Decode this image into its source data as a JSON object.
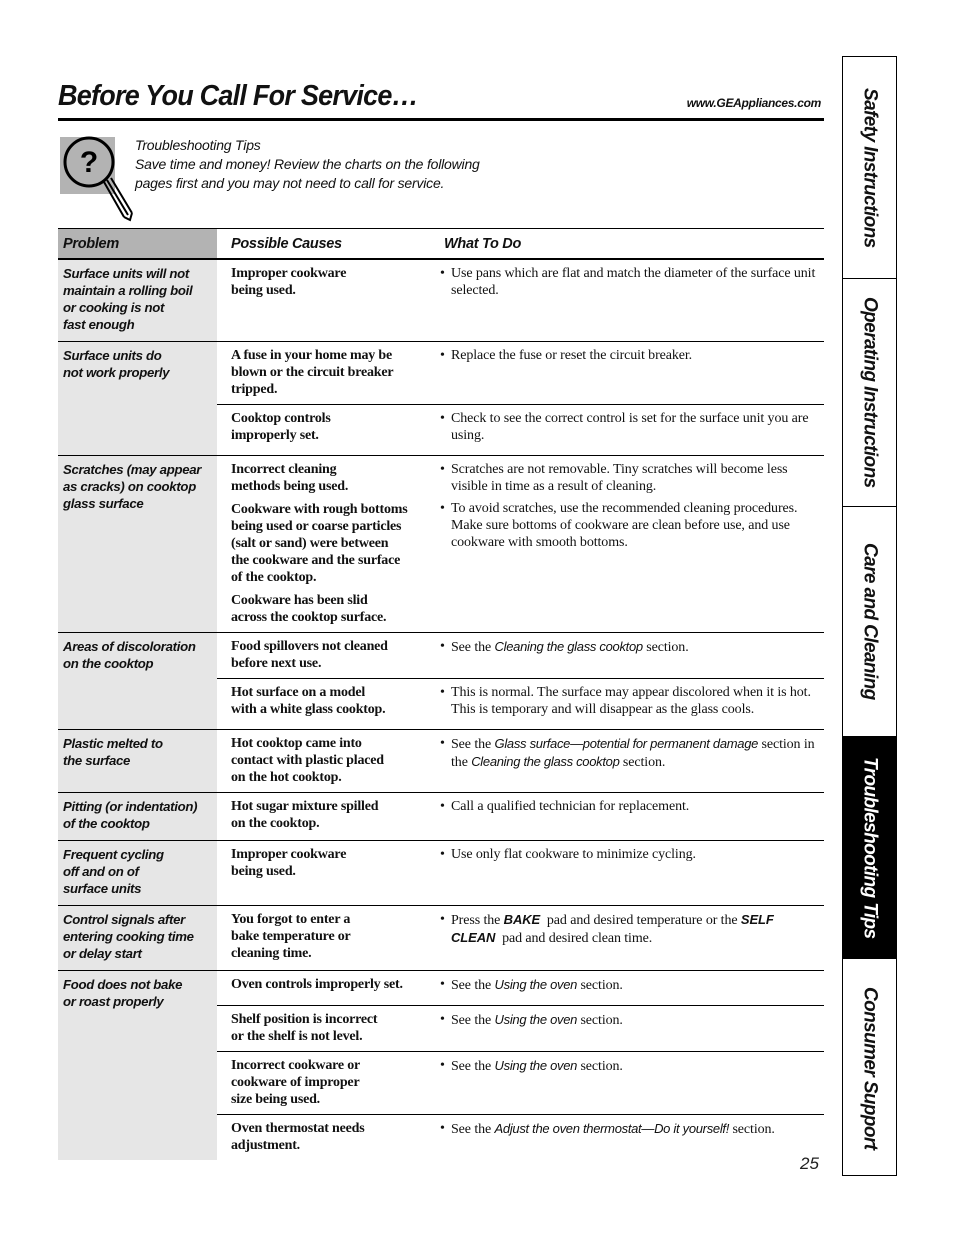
{
  "header": {
    "title": "Before You Call For Service…",
    "url": "www.GEAppliances.com"
  },
  "intro": {
    "icon": "magnifier-question-icon",
    "heading": "Troubleshooting Tips",
    "line1": "Save time and money! Review the charts on the following",
    "line2": "pages first and you may not need to call for service."
  },
  "table": {
    "columns": [
      "Problem",
      "Possible Causes",
      "What To Do"
    ],
    "rows": [
      {
        "problem": [
          "Surface units will not",
          "maintain a rolling boil",
          "or cooking is not",
          "fast enough"
        ],
        "causes": [
          {
            "cause": [
              "Improper cookware",
              "being used."
            ],
            "todo": [
              [
                {
                  "t": "Use pans which are flat and match the diameter of the surface unit selected."
                }
              ]
            ]
          }
        ]
      },
      {
        "problem": [
          "Surface units do",
          "not work properly"
        ],
        "causes": [
          {
            "cause": [
              "A fuse in your home may be",
              "blown or the circuit breaker",
              "tripped."
            ],
            "todo": [
              [
                {
                  "t": "Replace the fuse or reset the circuit breaker."
                }
              ]
            ]
          },
          {
            "divided": true,
            "cause": [
              "Cooktop controls",
              "improperly set."
            ],
            "todo": [
              [
                {
                  "t": "Check to see the correct control is set for the surface unit you are using."
                }
              ]
            ]
          }
        ]
      },
      {
        "problem": [
          "Scratches (may appear",
          "as cracks) on cooktop",
          "glass surface"
        ],
        "causes": [
          {
            "cause": [
              "Incorrect cleaning",
              "methods being used.",
              "",
              "Cookware with rough bottoms",
              "being used or coarse particles",
              "(salt or sand) were between",
              "the cookware and the surface",
              "of the cooktop.",
              "",
              "Cookware has been slid",
              "across the cooktop surface."
            ],
            "todo": [
              [
                {
                  "t": "Scratches are not removable. Tiny scratches will become less visible in time as a result of cleaning."
                }
              ],
              [
                {
                  "t": "To avoid scratches, use the recommended cleaning procedures. Make sure bottoms of cookware are clean before use, and use cookware with smooth bottoms."
                }
              ]
            ]
          }
        ]
      },
      {
        "problem": [
          "Areas of discoloration",
          "on the cooktop"
        ],
        "causes": [
          {
            "cause": [
              "Food spillovers not cleaned",
              "before next use."
            ],
            "todo": [
              [
                {
                  "t": "See the "
                },
                {
                  "t": "Cleaning the glass cooktop",
                  "s": "it"
                },
                {
                  "t": " section."
                }
              ]
            ]
          },
          {
            "divided": true,
            "cause": [
              "Hot surface on a model",
              "with a white glass cooktop."
            ],
            "todo": [
              [
                {
                  "t": "This is normal. The surface may appear discolored when it is hot. This is temporary and will disappear as the glass cools."
                }
              ]
            ]
          }
        ]
      },
      {
        "problem": [
          "Plastic melted to",
          "the surface"
        ],
        "causes": [
          {
            "cause": [
              "Hot cooktop came into",
              "contact with plastic placed",
              "on the hot cooktop."
            ],
            "todo": [
              [
                {
                  "t": "See the "
                },
                {
                  "t": "Glass surface—potential for permanent damage",
                  "s": "it"
                },
                {
                  "t": " section in the "
                },
                {
                  "t": "Cleaning the glass cooktop",
                  "s": "it"
                },
                {
                  "t": " section."
                }
              ]
            ]
          }
        ]
      },
      {
        "problem": [
          "Pitting (or indentation)",
          "of the cooktop"
        ],
        "causes": [
          {
            "cause": [
              "Hot sugar mixture spilled",
              "on the cooktop."
            ],
            "todo": [
              [
                {
                  "t": "Call a qualified technician for replacement."
                }
              ]
            ]
          }
        ]
      },
      {
        "problem": [
          "Frequent cycling",
          "off and on of",
          "surface units"
        ],
        "causes": [
          {
            "cause": [
              "Improper cookware",
              "being used."
            ],
            "todo": [
              [
                {
                  "t": "Use only flat cookware to minimize cycling."
                }
              ]
            ]
          }
        ]
      },
      {
        "problem": [
          "Control signals after",
          "entering cooking time",
          "or delay start"
        ],
        "causes": [
          {
            "cause": [
              "You forgot to enter a",
              "bake temperature or",
              "cleaning time."
            ],
            "todo": [
              [
                {
                  "t": "Press the "
                },
                {
                  "t": "BAKE",
                  "s": "bi"
                },
                {
                  "t": "  pad and desired temperature or the "
                },
                {
                  "t": "SELF CLEAN",
                  "s": "bi"
                },
                {
                  "t": "  pad and desired clean time."
                }
              ]
            ]
          }
        ]
      },
      {
        "problem": [
          "Food does not bake",
          "or roast properly"
        ],
        "last": true,
        "causes": [
          {
            "cause": [
              "Oven controls improperly set."
            ],
            "todo": [
              [
                {
                  "t": "See the "
                },
                {
                  "t": "Using the oven",
                  "s": "it"
                },
                {
                  "t": " section."
                }
              ]
            ]
          },
          {
            "divided": true,
            "cause": [
              "Shelf position is incorrect",
              "or the shelf is not level."
            ],
            "todo": [
              [
                {
                  "t": "See the "
                },
                {
                  "t": "Using the oven",
                  "s": "it"
                },
                {
                  "t": " section."
                }
              ]
            ]
          },
          {
            "divided": true,
            "cause": [
              "Incorrect cookware or",
              "cookware of improper",
              "size being used."
            ],
            "todo": [
              [
                {
                  "t": "See the "
                },
                {
                  "t": "Using the oven",
                  "s": "it"
                },
                {
                  "t": " section."
                }
              ]
            ]
          },
          {
            "divided": true,
            "cause": [
              "Oven thermostat needs",
              "adjustment."
            ],
            "todo": [
              [
                {
                  "t": "See the "
                },
                {
                  "t": "Adjust the oven thermostat—Do it yourself!",
                  "s": "it"
                },
                {
                  "t": " section."
                }
              ]
            ]
          }
        ]
      }
    ]
  },
  "page_number": "25",
  "side_tabs": [
    {
      "label": "Safety Instructions",
      "active": false
    },
    {
      "label": "Operating Instructions",
      "active": false
    },
    {
      "label": "Care and Cleaning",
      "active": false
    },
    {
      "label": "Troubleshooting Tips",
      "active": true
    },
    {
      "label": "Consumer Support",
      "active": false
    }
  ],
  "colors": {
    "header_gray": "#b3b3b3",
    "problem_column_gray": "#e6e6e6",
    "active_tab": "#000000"
  }
}
